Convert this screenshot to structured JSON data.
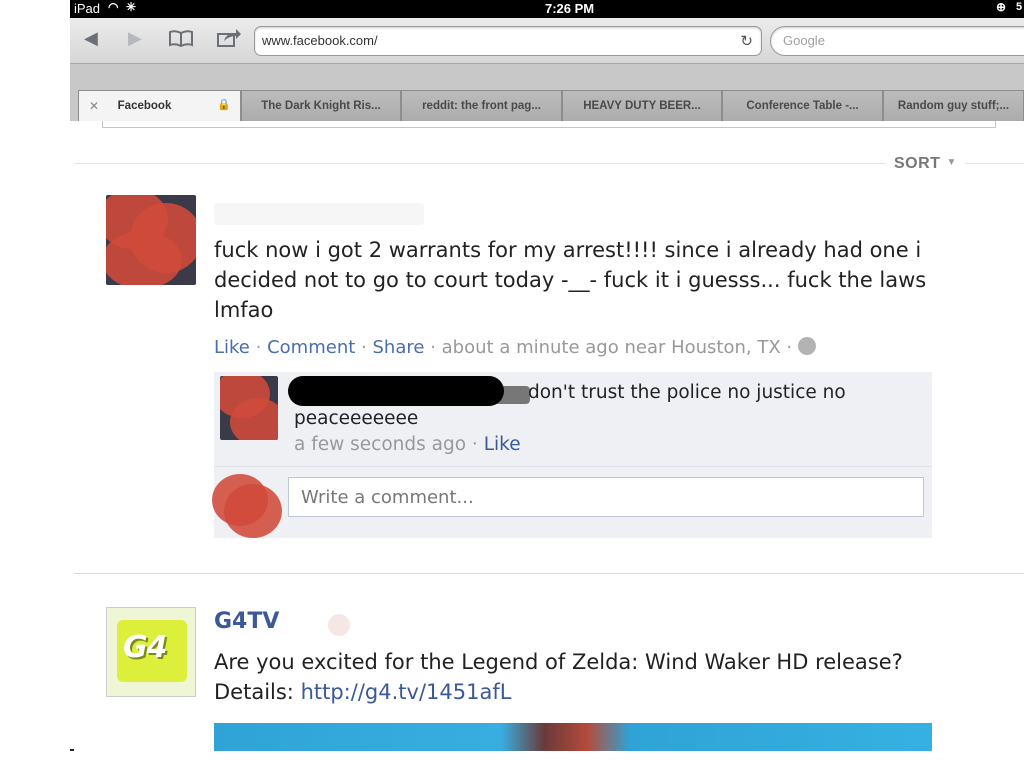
{
  "status_bar": {
    "device": "iPad",
    "time": "7:26 PM",
    "battery": "5"
  },
  "toolbar": {
    "url": "www.facebook.com/",
    "search_placeholder": "Google"
  },
  "tabs": [
    {
      "label": "Facebook",
      "active": true
    },
    {
      "label": "The Dark Knight Ris..."
    },
    {
      "label": "reddit: the front pag..."
    },
    {
      "label": "HEAVY DUTY BEER..."
    },
    {
      "label": "Conference Table -..."
    },
    {
      "label": "Random guy stuff;..."
    }
  ],
  "feed": {
    "sort_label": "SORT",
    "post1": {
      "text": "fuck now i got 2 warrants for my arrest!!!! since i already had one i decided not to go to court today -__- fuck it i guesss... fuck the laws lmfao",
      "actions": {
        "like": "Like",
        "comment": "Comment",
        "share": "Share",
        "sep": "·"
      },
      "meta": "about a minute ago near Houston, TX",
      "comment": {
        "text": "don't trust the police no justice no peaceeeeeee",
        "time": "a few seconds ago",
        "like": "Like"
      },
      "write_comment_placeholder": "Write a comment..."
    },
    "post2": {
      "author": "G4TV",
      "avatar_text": "G4",
      "text": "Are you excited for the Legend of Zelda: Wind Waker HD release? Details:",
      "link": "http://g4.tv/1451afL"
    }
  }
}
